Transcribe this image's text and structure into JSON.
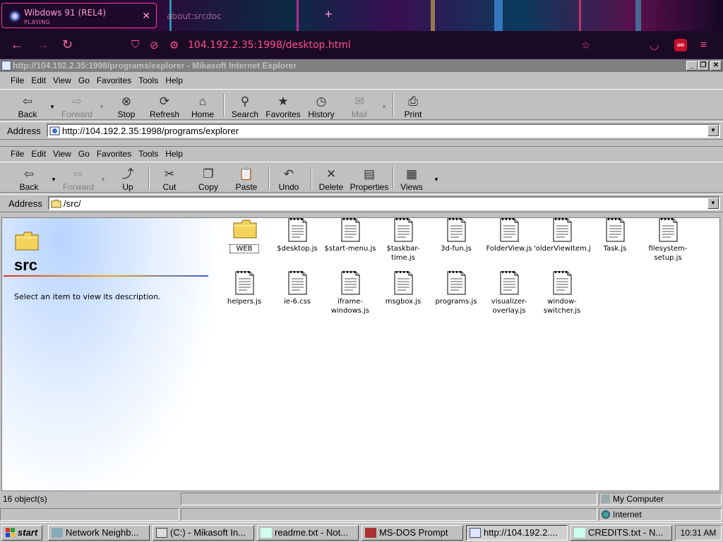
{
  "browser": {
    "active_tab": {
      "title": "Wibdows 91 (REL4)",
      "subtitle": "PLAYING"
    },
    "inactive_tab": {
      "title": "about:srcdoc"
    },
    "url": "104.192.2.35:1998/desktop.html"
  },
  "ie": {
    "title": "http://104.192.2.35:1998/programs/explorer - Mikasoft Internet Explorer",
    "menu": [
      "File",
      "Edit",
      "View",
      "Go",
      "Favorites",
      "Tools",
      "Help"
    ],
    "toolbar": {
      "back": "Back",
      "forward": "Forward",
      "stop": "Stop",
      "refresh": "Refresh",
      "home": "Home",
      "search": "Search",
      "favorites": "Favorites",
      "history": "History",
      "mail": "Mail",
      "print": "Print"
    },
    "address_label": "Address",
    "address": "http://104.192.2.35:1998/programs/explorer"
  },
  "explorer": {
    "menu": [
      "File",
      "Edit",
      "View",
      "Go",
      "Favorites",
      "Tools",
      "Help"
    ],
    "toolbar": {
      "back": "Back",
      "forward": "Forward",
      "up": "Up",
      "cut": "Cut",
      "copy": "Copy",
      "paste": "Paste",
      "undo": "Undo",
      "delete": "Delete",
      "properties": "Properties",
      "views": "Views"
    },
    "address_label": "Address",
    "address": "/src/",
    "folder_name": "src",
    "description": "Select an item to view its description.",
    "files": [
      {
        "name": "WEB",
        "type": "folder"
      },
      {
        "name": "$desktop.js",
        "type": "file"
      },
      {
        "name": "$start-menu.js",
        "type": "file"
      },
      {
        "name": "$taskbar-\ntime.js",
        "type": "file"
      },
      {
        "name": "3d-fun.js",
        "type": "file"
      },
      {
        "name": "FolderView.js",
        "type": "file"
      },
      {
        "name": "'olderViewItem.j",
        "type": "file"
      },
      {
        "name": "Task.js",
        "type": "file"
      },
      {
        "name": "filesystem-\nsetup.js",
        "type": "file"
      },
      {
        "name": "helpers.js",
        "type": "file"
      },
      {
        "name": "ie-6.css",
        "type": "file"
      },
      {
        "name": "iframe-\nwindows.js",
        "type": "file"
      },
      {
        "name": "msgbox.js",
        "type": "file"
      },
      {
        "name": "programs.js",
        "type": "file"
      },
      {
        "name": "visualizer-\noverlay.js",
        "type": "file"
      },
      {
        "name": "window-\nswitcher.js",
        "type": "file"
      }
    ]
  },
  "status": {
    "objects": "16 object(s)",
    "location": "My Computer",
    "zone": "Internet"
  },
  "taskbar": {
    "start": "start",
    "items": [
      "Network Neighb...",
      "(C:) - Mikasoft In...",
      "readme.txt - Not...",
      "MS-DOS Prompt",
      "http://104.192.2....",
      "CREDITS.txt - N..."
    ],
    "clock": "10:31 AM"
  }
}
